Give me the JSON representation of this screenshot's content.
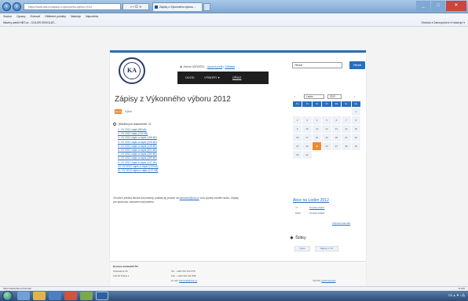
{
  "browser": {
    "address": "https://www.cka.cz/zapisy-z-vykonneho-vyboru-2012",
    "tab_title": "Zápisy z Výkonného výboru ...",
    "menu": [
      "Soubor",
      "Úpravy",
      "Zobrazit",
      "Oblíbené položky",
      "Nástroje",
      "Nápověda"
    ],
    "favorites": "Návrhy webů   HBT.cz - COLOR DEKOLAT...",
    "toolbar_right": "Stránka ▾   Zabezpečení ▾   Nástroje ▾",
    "status_url": "https://www.cka.cz/cs/node",
    "zoom": "% 100"
  },
  "site": {
    "logo_text": "KA",
    "user_line": "Jméno UŽIVATEL",
    "user_links": [
      "Upravit profil",
      "Odhlásit"
    ],
    "search_value": "Hledat",
    "search_button": "Hledat",
    "nav": [
      "ÚVOD",
      "VÝBORY ▾",
      "ÚŘAD"
    ]
  },
  "main": {
    "title": "Zápisy z Výkonného výboru 2012",
    "badge": "Zápis",
    "badge_link": "Výbor",
    "attachments_label": "přiložených dokumentů: 11",
    "attachments": [
      "1. VV 2012 zápis (85 kB)",
      "2. VV 2012 zápis (104 kB)",
      "3. VV 2012 zápis a zápis (166 kB)",
      "4. VV 2012 zápis a zápis (349 kB)",
      "5. VV 2012 zápis a zápis (149 kB)",
      "6. VV 2012 zápis a zápis (301 kB)",
      "7. VV 2012 zápis a zápis (154 kB)",
      "8. VV 2012 zápis a zápis (289 kB)",
      "9. VV 2012 zápis a zápis (241 kB)",
      "10. VV 2012 zápis a zápis (223 kB)",
      "11. VV 2012 zápis a zápis (127 kB)"
    ],
    "note_text": "Chcete-li přečíst dlouhé dokumenty, pošlete jej prosím na",
    "note_link": "kancelar@cka.cz",
    "note_text2": "a do zprávy uveďte název. Zápisy pro správnou zobrazení dokumentu."
  },
  "sidebar": {
    "calendar_prev": "‹",
    "calendar_next": "›",
    "calendar_month": "Leden",
    "calendar_year": "2012",
    "weekdays": [
      "Po",
      "Út",
      "St",
      "Čt",
      "Pá",
      "So",
      "Ne"
    ],
    "days": [
      "",
      "",
      "",
      "",
      "",
      "",
      "1",
      "2",
      "3",
      "4",
      "5",
      "6",
      "7",
      "8",
      "9",
      "10",
      "11",
      "12",
      "13",
      "14",
      "15",
      "16",
      "17",
      "18",
      "19",
      "20",
      "21",
      "22",
      "23",
      "24",
      "25",
      "26",
      "27",
      "28",
      "29",
      "30",
      "31",
      "",
      "",
      "",
      "",
      ""
    ],
    "today": "25",
    "archive_link": "Akce na Leden 2012",
    "event_day": "25",
    "event_dayname": "leden",
    "event_title": "Porada oblastí",
    "event_sub": "Porada oblasti",
    "event_more": "Zobrazit kalendář",
    "tags_title": "Štítky",
    "tags": [
      "Výbor",
      "Zápisy z VV"
    ]
  },
  "footer": {
    "org": "Komora architektů ČR",
    "addr1": "Opletalova 56",
    "addr2": "110 00 Praha 1",
    "tel": "Tel.: +420 224 212 878",
    "fax": "Fax.: +420 224 211 805",
    "email_label": "E-mail:",
    "email": "kancelar@cka.cz",
    "credit_label": "Vytvořil:",
    "credit": "webFreeware"
  },
  "colors": {
    "accent": "#2a6ebb",
    "highlight": "#f0882f",
    "nav": "#1e1e1e"
  }
}
